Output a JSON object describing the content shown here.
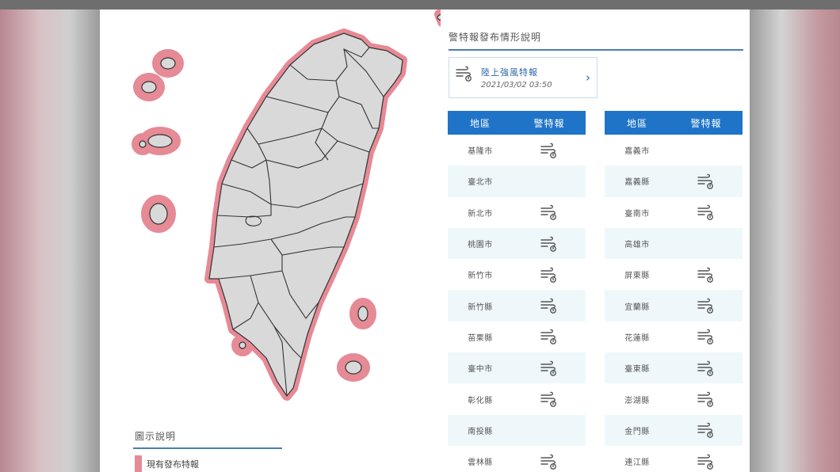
{
  "map": {
    "legend_title": "圖示說明",
    "legend_item": "現有發布特報",
    "highlight_color": "#e68a95",
    "land_color": "#d9d9d9"
  },
  "panel": {
    "title": "警特報發布情形說明",
    "warning": {
      "icon": "strong-wind-icon",
      "name": "陸上強風特報",
      "time": "2021/03/02 03:50"
    },
    "columns": {
      "region": "地區",
      "warning": "警特報"
    }
  },
  "table_left": [
    {
      "name": "基隆市",
      "warn": true
    },
    {
      "name": "臺北市",
      "warn": false
    },
    {
      "name": "新北市",
      "warn": true
    },
    {
      "name": "桃園市",
      "warn": true
    },
    {
      "name": "新竹市",
      "warn": true
    },
    {
      "name": "新竹縣",
      "warn": true
    },
    {
      "name": "苗栗縣",
      "warn": true
    },
    {
      "name": "臺中市",
      "warn": true
    },
    {
      "name": "彰化縣",
      "warn": true
    },
    {
      "name": "南投縣",
      "warn": false
    },
    {
      "name": "雲林縣",
      "warn": true
    }
  ],
  "table_right": [
    {
      "name": "嘉義市",
      "warn": false
    },
    {
      "name": "嘉義縣",
      "warn": true
    },
    {
      "name": "臺南市",
      "warn": true
    },
    {
      "name": "高雄市",
      "warn": false
    },
    {
      "name": "屏東縣",
      "warn": true
    },
    {
      "name": "宜蘭縣",
      "warn": true
    },
    {
      "name": "花蓮縣",
      "warn": true
    },
    {
      "name": "臺東縣",
      "warn": true
    },
    {
      "name": "澎湖縣",
      "warn": true
    },
    {
      "name": "金門縣",
      "warn": true
    },
    {
      "name": "連江縣",
      "warn": true
    }
  ]
}
